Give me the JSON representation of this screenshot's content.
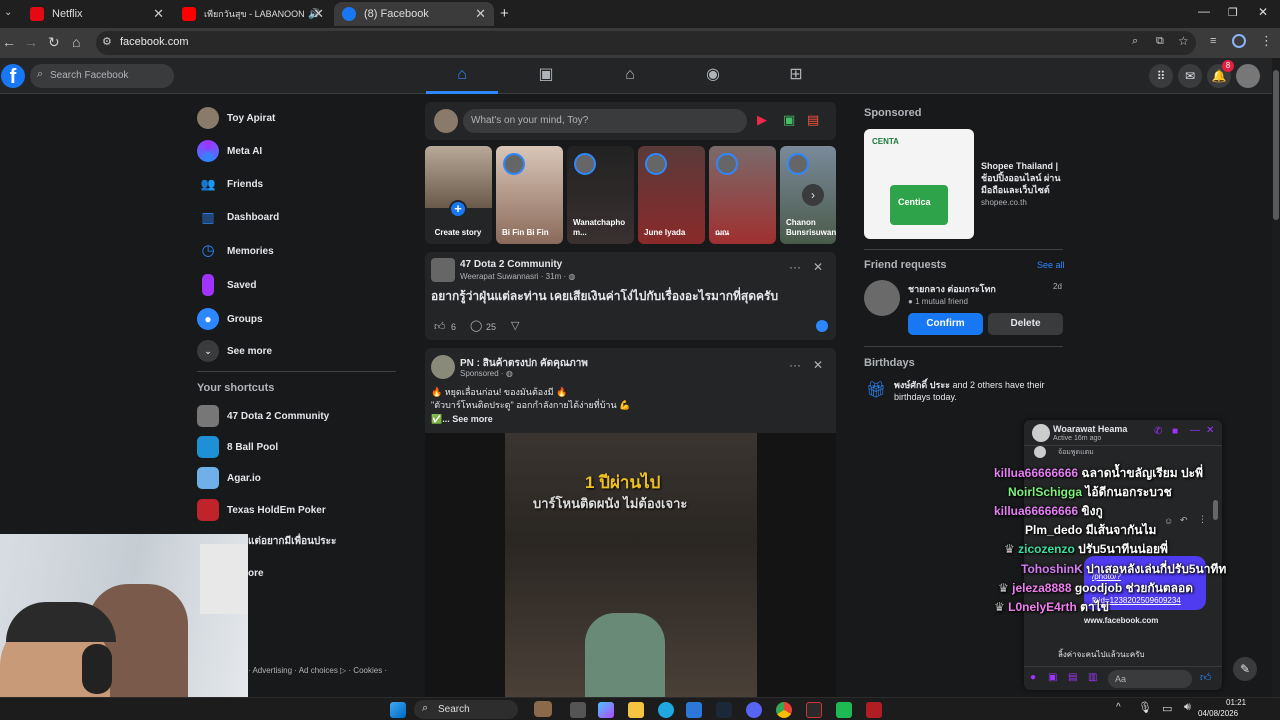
{
  "browser": {
    "tabs": [
      {
        "title": "Netflix",
        "color": "#e50914"
      },
      {
        "title": "เพียกวันสุข - LABANOON | ฝน",
        "color": "#ff0000"
      },
      {
        "title": "(8) Facebook",
        "color": "#1877f2"
      }
    ],
    "new_tab_label": "+",
    "url": "facebook.com"
  },
  "fb_header": {
    "logo_letter": "f",
    "search_placeholder": "Search Facebook",
    "notification_count": "8"
  },
  "left_sidebar": {
    "items": [
      {
        "label": "Toy Apirat",
        "icon": "avatar"
      },
      {
        "label": "Meta AI",
        "icon": "meta-ai-icon"
      },
      {
        "label": "Friends",
        "icon": "friends-icon"
      },
      {
        "label": "Dashboard",
        "icon": "dashboard-icon"
      },
      {
        "label": "Memories",
        "icon": "memories-icon"
      },
      {
        "label": "Saved",
        "icon": "saved-icon"
      },
      {
        "label": "Groups",
        "icon": "groups-icon"
      },
      {
        "label": "See more",
        "icon": "chevron-down-icon"
      }
    ],
    "shortcuts_title": "Your shortcuts",
    "shortcuts": [
      {
        "label": "47 Dota 2 Community"
      },
      {
        "label": "8 Ball Pool"
      },
      {
        "label": "Agar.io"
      },
      {
        "label": "Texas HoldEm Poker"
      },
      {
        "label": "แต่อยากมีเพื่อนประะ"
      },
      {
        "label": "ore"
      }
    ],
    "footer": "· Advertising · Ad choices ▷ · Cookies ·"
  },
  "composer": {
    "placeholder": "What's on your mind, Toy?"
  },
  "stories": [
    {
      "name": "Create story"
    },
    {
      "name": "Bi Fin Bi Fin"
    },
    {
      "name": "Wanatchapho m..."
    },
    {
      "name": "June Iyada"
    },
    {
      "name": "ฌณ"
    },
    {
      "name": "Chanon Bunsrisuwan"
    }
  ],
  "post1": {
    "group": "47 Dota 2 Community",
    "author": "Weerapat Suwannasri",
    "time": "31m",
    "text": "อยากรู้ว่าฝุ่นแต่ละท่าน เคยเสียเงินค่าโง่ไปกับเรื่องอะไรมากที่สุดครับ",
    "likes": "6",
    "comments": "25"
  },
  "post2": {
    "page": "PN : สินค้าตรงปก คัดคุณภาพ",
    "sponsored": "Sponsored",
    "line1": "🔥 หยุดเลื่อนก่อน! ของมันต้องมี 🔥",
    "line2": "\"ตัวบาร์โหนติดประตู\" ออกกำลังกายได้ง่ายที่บ้าน 💪",
    "see_more": "✅... See more",
    "video_caption1": "1 ปีผ่านไป",
    "video_caption2": "บาร์โหนติดผนัง ไม่ต้องเจาะ"
  },
  "right_column": {
    "sponsored_title": "Sponsored",
    "ad_name": "Shopee Thailand | ช้อปปิ้งออนไลน์ ผ่านมือถือและเว็บไซต์",
    "ad_url": "shopee.co.th",
    "ad_brand": "CENTA",
    "ad_product": "Centica",
    "friend_requests_title": "Friend requests",
    "see_all": "See all",
    "request_name": "ชายกลาง ต่อมกระโทก",
    "request_mutual": "1 mutual friend",
    "request_age": "2d",
    "confirm": "Confirm",
    "delete": "Delete",
    "birthdays_title": "Birthdays",
    "birthday_name": "พงษ์ศักดิ์ ประะ",
    "birthday_text": " and 2 others have their birthdays today."
  },
  "chat": {
    "name": "Woarawat Heama",
    "status": "Active 16m ago",
    "input_placeholder": "Aa",
    "link_domain": "www.facebook.com",
    "link_text1": "/photo/?",
    "link_text2": "fbid=1238202509609234",
    "bottom_msg": "ลิ้งค่าจะคนไปแล้วนะครับ",
    "top_msg": "จ้อมพูดแตม"
  },
  "stream_overlay": [
    {
      "user": "killua66666666",
      "msg": "ฉลาดน้ำขลัญเรียม ปะพี่",
      "color": "#e67ef5"
    },
    {
      "user": "NoirlSchigga",
      "msg": "ไอ้ดีกนอกระบวช",
      "color": "#7cf27c"
    },
    {
      "user": "killua66666666",
      "msg": "ขิงกู",
      "color": "#e67ef5"
    },
    {
      "user": "Plm_dedo",
      "msg": "มีเส้นจากันไม",
      "color": "#ffffff"
    },
    {
      "user": "zicozenzo",
      "msg": "ปรับ5นาทีนน่อยพี่",
      "color": "#36e0a0"
    },
    {
      "user": "TohoshinK",
      "msg": "ปาเสอหลังเล่นกี่ปรับ5นาทีท",
      "color": "#d67cf5"
    },
    {
      "user": "jeleza8888",
      "msg": "goodjob ช่วยกันตลอด",
      "color": "#f07ef0"
    },
    {
      "user": "L0nelyE4rth",
      "msg": "ตาไข่",
      "color": "#f07ef0"
    }
  ],
  "taskbar": {
    "search_label": "Search",
    "time": "01:21",
    "date": "04/08/2026"
  }
}
